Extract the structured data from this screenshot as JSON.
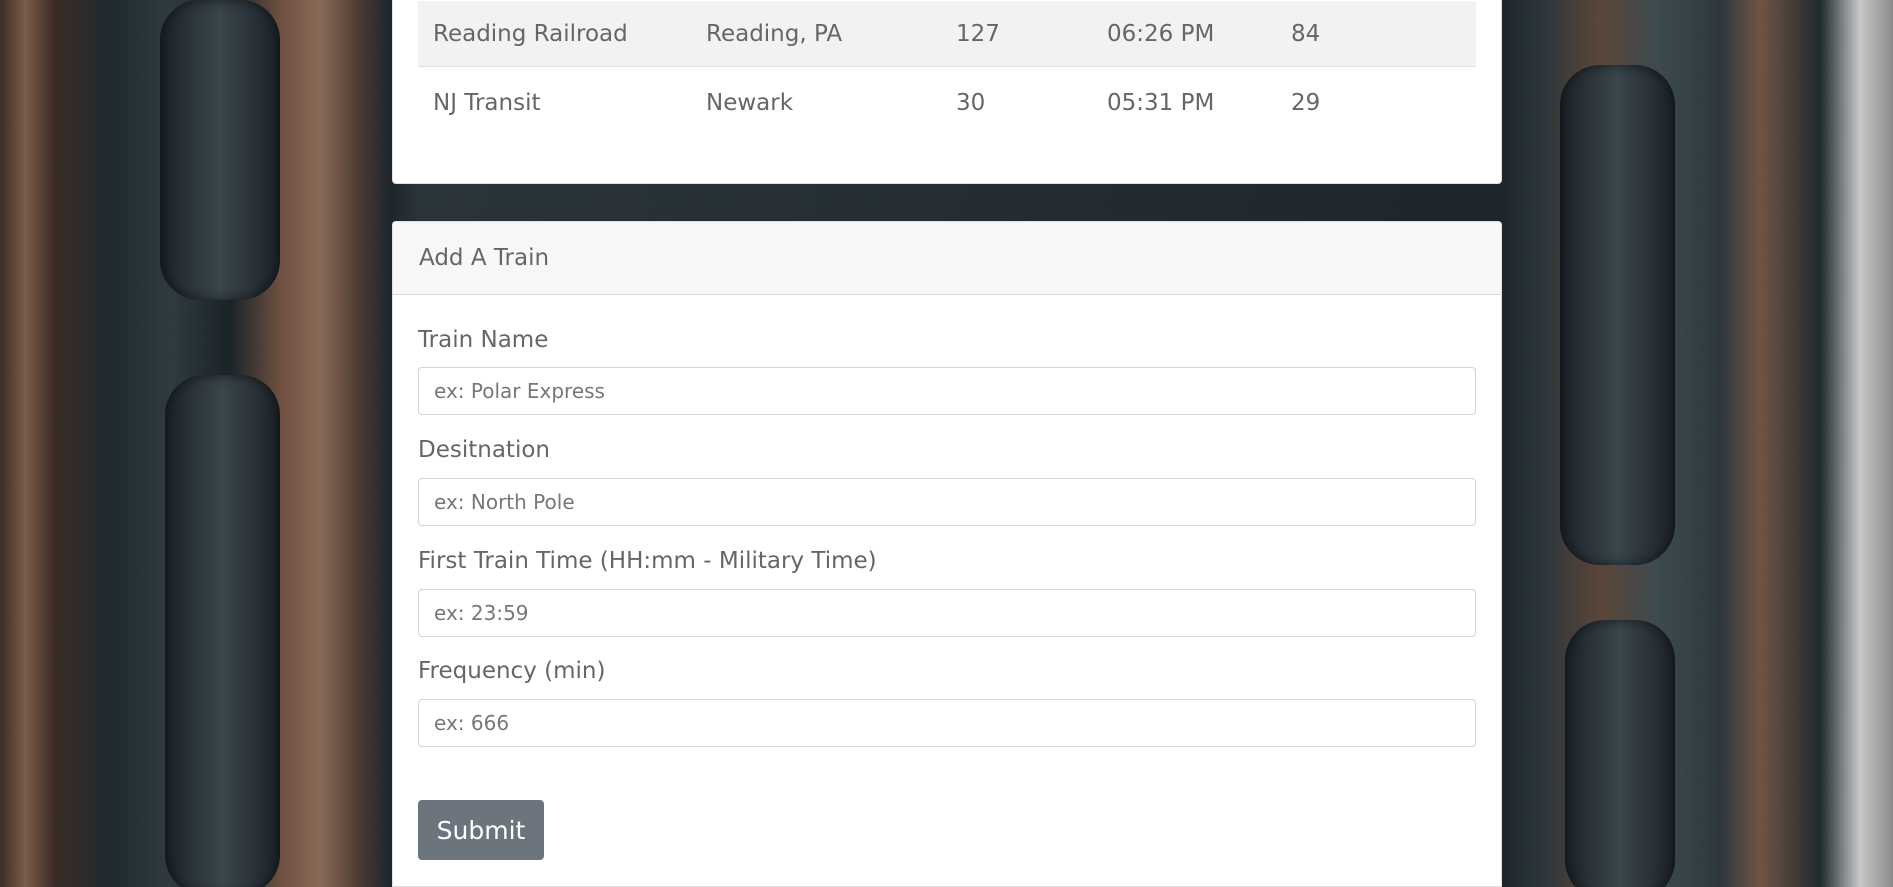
{
  "schedule": {
    "rows": [
      {
        "name": "Reading Railroad",
        "destination": "Reading, PA",
        "frequency": "127",
        "next_arrival": "06:26 PM",
        "minutes_away": "84"
      },
      {
        "name": "NJ Transit",
        "destination": "Newark",
        "frequency": "30",
        "next_arrival": "05:31 PM",
        "minutes_away": "29"
      }
    ]
  },
  "add_train": {
    "header": "Add A Train",
    "fields": {
      "train_name": {
        "label": "Train Name",
        "placeholder": "ex: Polar Express",
        "value": ""
      },
      "destination": {
        "label": "Desitnation",
        "placeholder": "ex: North Pole",
        "value": ""
      },
      "first_time": {
        "label": "First Train Time (HH:mm - Military Time)",
        "placeholder": "ex: 23:59",
        "value": ""
      },
      "frequency": {
        "label": "Frequency (min)",
        "placeholder": "ex: 666",
        "value": ""
      }
    },
    "submit_label": "Submit"
  },
  "colors": {
    "button": "#6c757d",
    "header_bg": "#f7f7f7",
    "striped_row": "#f2f2f2"
  }
}
